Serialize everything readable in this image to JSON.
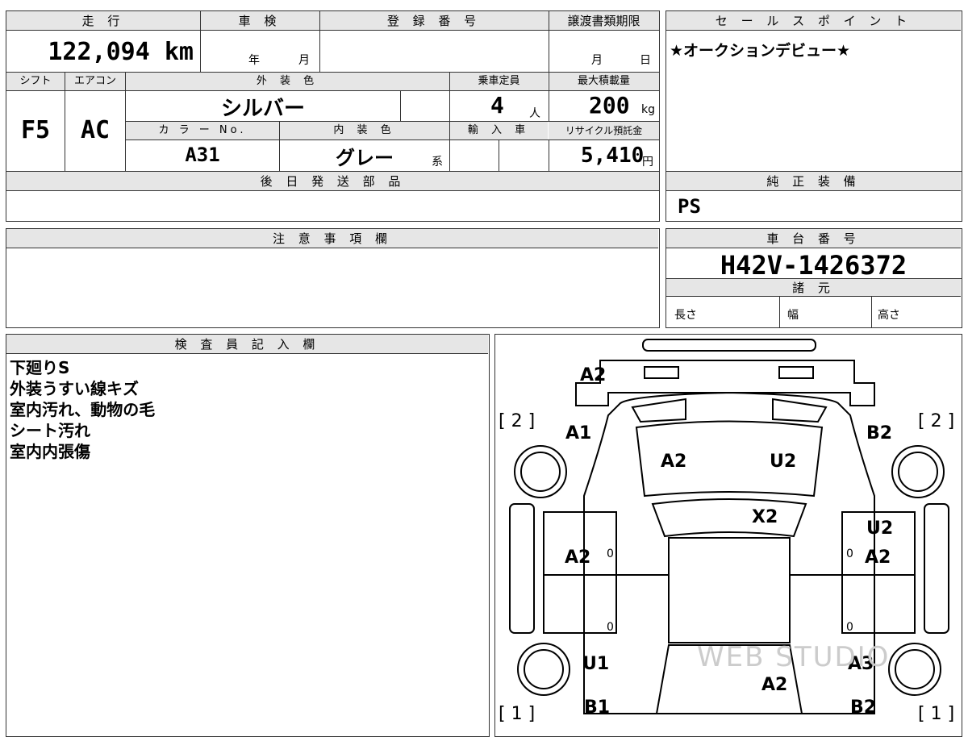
{
  "top": {
    "mileage_label": "走 行",
    "mileage_value": "122,094 km",
    "inspection_label": "車 検",
    "inspection_year": "年",
    "inspection_month": "月",
    "registration_label": "登 録 番 号",
    "transfer_label": "譲渡書類期限",
    "transfer_month": "月",
    "transfer_day": "日",
    "shift_label": "シフト",
    "aircon_label": "エアコン",
    "exterior_label": "外 装 色",
    "capacity_label": "乗車定員",
    "maxload_label": "最大積載量",
    "shift_value": "F5",
    "aircon_value": "AC",
    "exterior_value": "シルバー",
    "capacity_value": "4",
    "capacity_unit": "人",
    "maxload_value": "200",
    "maxload_unit": "kg",
    "colorno_label": "カ ラ ー No.",
    "interior_label": "内 装 色",
    "import_label": "輸 入 車",
    "recycle_label": "リサイクル預託金",
    "colorno_value": "A31",
    "interior_value": "グレー",
    "interior_suffix": "系",
    "recycle_value": "5,410",
    "recycle_unit": "円",
    "later_parts_label": "後 日 発 送 部 品",
    "sales_label": "セ ー ル ス ポ イ ン ト",
    "sales_value": "★オークションデビュー★",
    "equip_label": "純 正 装 備",
    "equip_value": "PS",
    "caution_label": "注 意 事 項 欄",
    "chassis_label": "車 台 番 号",
    "chassis_value": "H42V-1426372",
    "specs_label": "諸 元",
    "length_label": "長さ",
    "width_label": "幅",
    "height_label": "高さ"
  },
  "inspector": {
    "label": "検 査 員 記 入 欄",
    "notes": [
      "下廻りS",
      "外装うすい線キズ",
      "室内汚れ、動物の毛",
      "シート汚れ",
      "室内内張傷"
    ]
  },
  "diagram": {
    "codes": {
      "front_top": "A2",
      "front_left": "A1",
      "front_right": "B2",
      "hood_left": "A2",
      "hood_right": "U2",
      "windshield": "X2",
      "right_front_door_a": "U2",
      "right_front_door_b": "A2",
      "left_front_door": "A2",
      "left_rear": "U1",
      "right_rear": "A3",
      "roof_rear": "A2",
      "left_bottom": "B1",
      "right_bottom": "B2"
    },
    "tire_marks": {
      "front_left": "[ 2 ]",
      "front_right": "[ 2 ]",
      "rear_left": "[ 1 ]",
      "rear_right": "[ 1 ]"
    },
    "zeros": [
      "0",
      "0",
      "0",
      "0"
    ],
    "watermark": "WEB STUDIO"
  }
}
